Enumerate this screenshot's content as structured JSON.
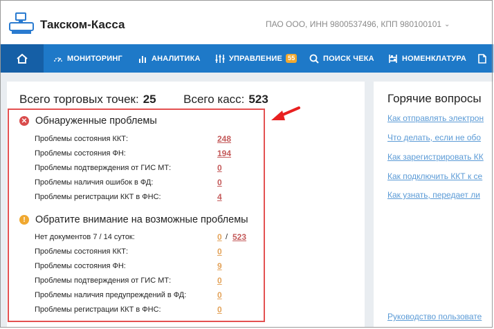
{
  "header": {
    "app_title": "Такском-Касса",
    "org_info": "ПАО ООО, ИНН 9800537496, КПП 980100101"
  },
  "nav": {
    "items": [
      {
        "label": "МОНИТОРИНГ"
      },
      {
        "label": "АНАЛИТИКА"
      },
      {
        "label": "УПРАВЛЕНИЕ",
        "badge": "55"
      },
      {
        "label": "ПОИСК ЧЕКА"
      },
      {
        "label": "НОМЕНКЛАТУРА"
      }
    ]
  },
  "totals": {
    "points_label": "Всего торговых точек:",
    "points_value": "25",
    "kkt_label": "Всего касс:",
    "kkt_value": "523"
  },
  "detected": {
    "title": "Обнаруженные проблемы",
    "rows": [
      {
        "label": "Проблемы состояния ККТ:",
        "value": "248"
      },
      {
        "label": "Проблемы состояния ФН:",
        "value": "194"
      },
      {
        "label": "Проблемы подтверждения от ГИС МТ:",
        "value": "0"
      },
      {
        "label": "Проблемы наличия ошибок в ФД:",
        "value": "0"
      },
      {
        "label": "Проблемы регистрации ККТ в ФНС:",
        "value": "4"
      }
    ]
  },
  "attention": {
    "title": "Обратите внимание на возможные проблемы",
    "nodocs_label": "Нет документов 7 / 14 суток:",
    "nodocs_value1": "0",
    "nodocs_sep": "/",
    "nodocs_value2": "523",
    "rows": [
      {
        "label": "Проблемы состояния ККТ:",
        "value": "0"
      },
      {
        "label": "Проблемы состояния ФН:",
        "value": "9"
      },
      {
        "label": "Проблемы подтверждения от ГИС МТ:",
        "value": "0"
      },
      {
        "label": "Проблемы наличия предупреждений в ФД:",
        "value": "0"
      },
      {
        "label": "Проблемы регистрации ККТ в ФНС:",
        "value": "0"
      }
    ]
  },
  "hot": {
    "title": "Горячие вопросы",
    "links": [
      "Как отправлять электрон",
      "Что делать, если не обо",
      "Как зарегистрировать КК",
      "Как подключить ККТ к се",
      "Как узнать, передает ли"
    ],
    "footer_link": "Руководство пользовате"
  },
  "colors": {
    "nav_bg": "#1e79c8",
    "nav_active": "#155fa6",
    "error": "#d94c4c",
    "warning": "#f0a830",
    "highlight": "#e35050"
  }
}
